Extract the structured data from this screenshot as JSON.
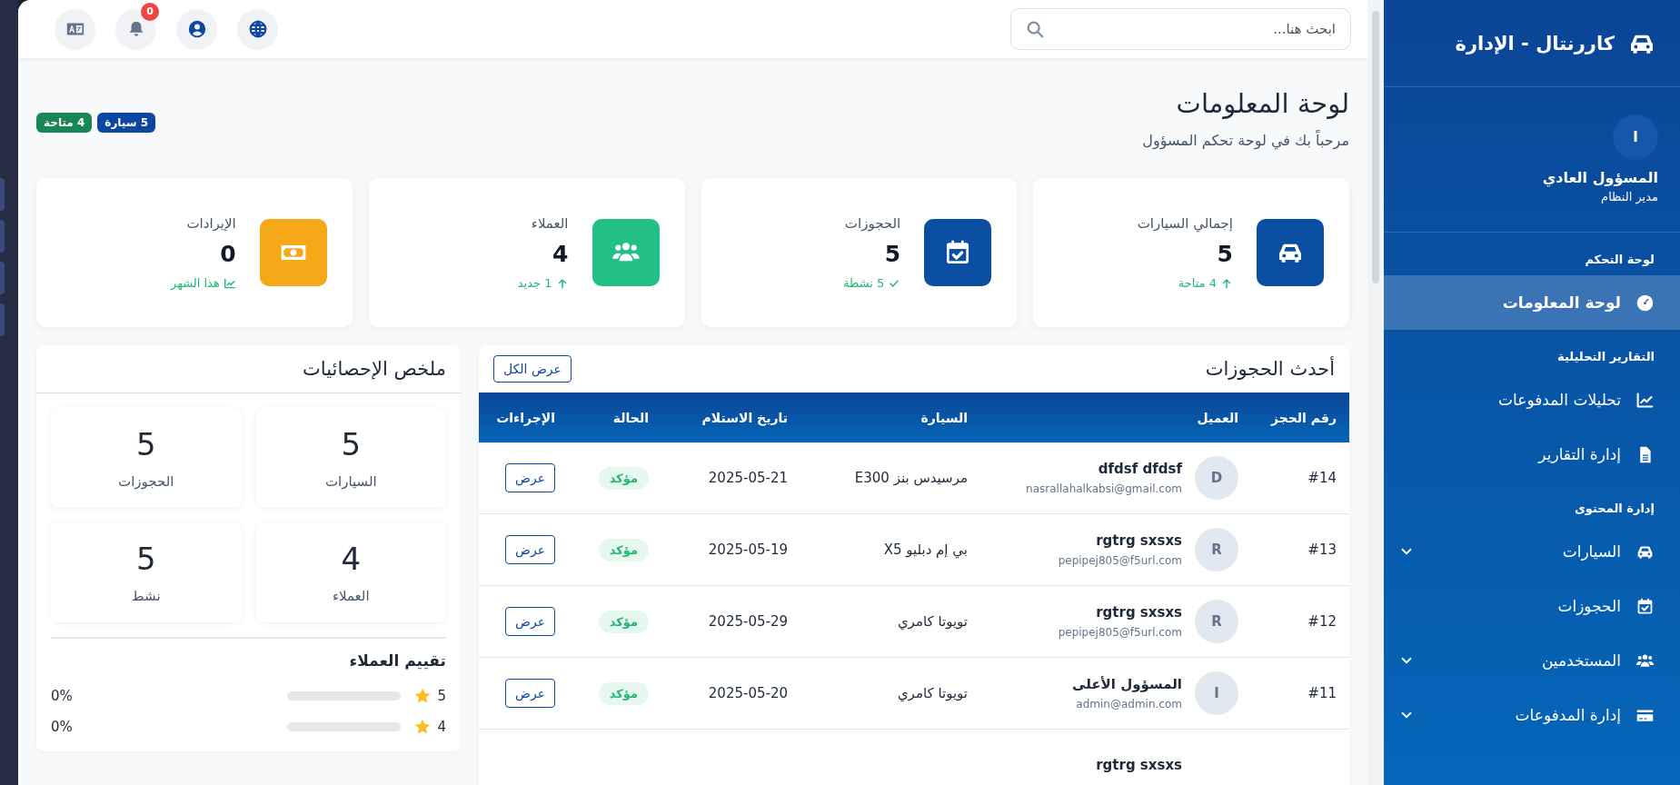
{
  "topbar": {
    "search": {
      "placeholder": "ابحث هنا..."
    },
    "notifications": {
      "count": "0"
    }
  },
  "page": {
    "title": "لوحة المعلومات",
    "subtitle": "مرحباً بك في لوحة تحكم المسؤول",
    "badges": [
      {
        "label": "5 سيارة",
        "color": "#0d47a1"
      },
      {
        "label": "4 متاحة",
        "color": "#198754"
      }
    ]
  },
  "stat_cards": [
    {
      "kind": "cars",
      "label": "إجمالي السيارات",
      "value": "5",
      "trend": "4 متاحة",
      "color": "#0b4fa3"
    },
    {
      "kind": "bookings",
      "label": "الحجوزات",
      "value": "5",
      "trend": "5 نشطة",
      "color": "#0b4fa3"
    },
    {
      "kind": "clients",
      "label": "العملاء",
      "value": "4",
      "trend": "1 جديد",
      "color": "#22bf86"
    },
    {
      "kind": "revenue",
      "label": "الإيرادات",
      "value": "0",
      "trend": "هذا الشهر",
      "color": "#f5a818"
    }
  ],
  "recent_bookings": {
    "title": "أحدث الحجوزات",
    "view_all": "عرض الكل",
    "columns": [
      "رقم الحجز",
      "العميل",
      "السيارة",
      "تاريخ الاستلام",
      "الحالة",
      "الإجراءات"
    ],
    "rows": [
      {
        "number": "#14",
        "initial": "D",
        "client": "dfdsf dfdsf",
        "email": "nasrallahalkabsi@gmail.com",
        "car": "مرسيدس بنز E300",
        "date": "2025-05-21",
        "status": "مؤكد",
        "action": "عرض"
      },
      {
        "number": "#13",
        "initial": "R",
        "client": "rgtrg sxsxs",
        "email": "pepipej805@f5url.com",
        "car": "بي إم دبليو X5",
        "date": "2025-05-19",
        "status": "مؤكد",
        "action": "عرض"
      },
      {
        "number": "#12",
        "initial": "R",
        "client": "rgtrg sxsxs",
        "email": "pepipej805@f5url.com",
        "car": "تويوتا كامري",
        "date": "2025-05-29",
        "status": "مؤكد",
        "action": "عرض"
      },
      {
        "number": "#11",
        "initial": "I",
        "client": "المسؤول الأعلى",
        "email": "admin@admin.com",
        "car": "تويوتا كامري",
        "date": "2025-05-20",
        "status": "مؤكد",
        "action": "عرض"
      },
      {
        "client": "rgtrg sxsxs"
      }
    ]
  },
  "stats_summary": {
    "title": "ملخص الإحصائيات",
    "tiles": [
      {
        "value": "5",
        "label": "السيارات"
      },
      {
        "value": "5",
        "label": "الحجوزات"
      },
      {
        "value": "4",
        "label": "العملاء"
      },
      {
        "value": "5",
        "label": "نشط"
      }
    ],
    "ratings_title": "تقييم العملاء",
    "ratings": [
      {
        "label": "5",
        "level": 0,
        "percent": "0%"
      },
      {
        "label": "4",
        "level": 0,
        "percent": "0%"
      }
    ]
  },
  "sidebar": {
    "brand": "كاررنتال - الإدارة",
    "user": {
      "initial": "I",
      "name": "المسؤول العادي",
      "role": "مدير النظام"
    },
    "sections": [
      {
        "title": "لوحة التحكم",
        "items": [
          {
            "kind": "dashboard",
            "label": "لوحة المعلومات",
            "selected": true,
            "has_submenu": false
          }
        ]
      },
      {
        "title": "التقارير التحليلية",
        "items": [
          {
            "kind": "analytics",
            "label": "تحليلات المدفوعات",
            "selected": false,
            "has_submenu": false
          },
          {
            "kind": "reports",
            "label": "إدارة التقارير",
            "selected": false,
            "has_submenu": false
          }
        ]
      },
      {
        "title": "إدارة المحتوى",
        "items": [
          {
            "kind": "cars",
            "label": "السيارات",
            "selected": false,
            "has_submenu": true
          },
          {
            "kind": "bookings",
            "label": "الحجوزات",
            "selected": false,
            "has_submenu": false
          },
          {
            "kind": "users",
            "label": "المستخدمين",
            "selected": false,
            "has_submenu": true
          },
          {
            "kind": "payments",
            "label": "إدارة المدفوعات",
            "selected": false,
            "has_submenu": true
          }
        ]
      }
    ]
  }
}
